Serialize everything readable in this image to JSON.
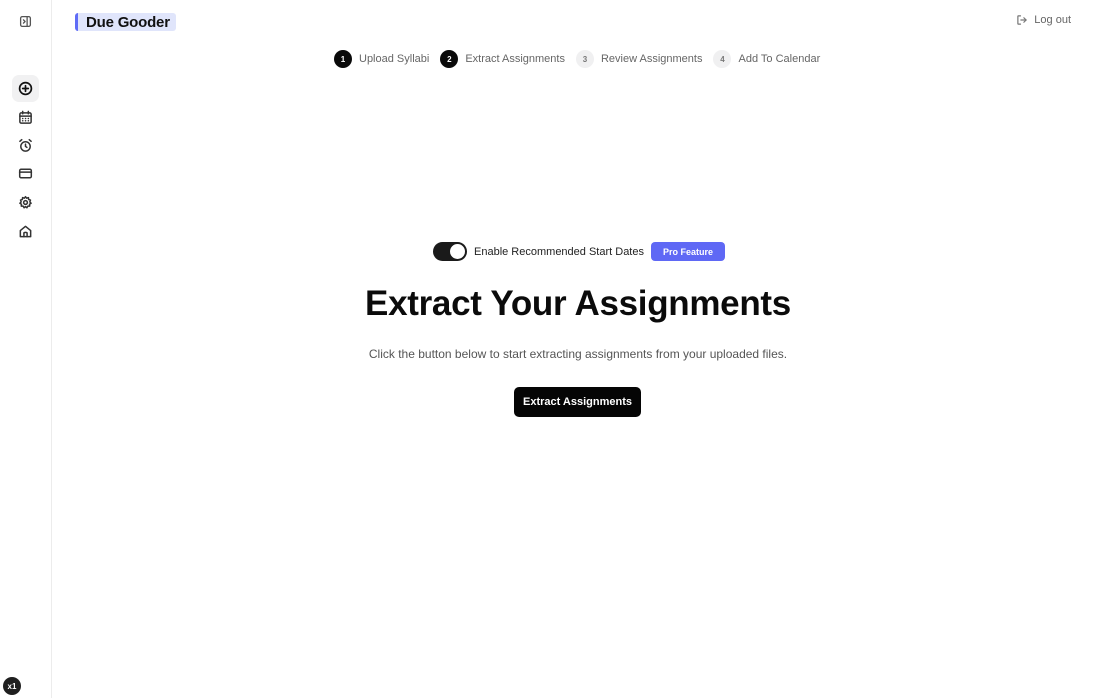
{
  "app": {
    "logo_text": "Due Gooder",
    "logout_label": "Log out",
    "zoom_badge": "x1"
  },
  "sidebar": {
    "items": [
      {
        "icon": "plus-circle-icon",
        "active": true
      },
      {
        "icon": "calendar-icon",
        "active": false
      },
      {
        "icon": "alarm-clock-icon",
        "active": false
      },
      {
        "icon": "credit-card-icon",
        "active": false
      },
      {
        "icon": "gear-icon",
        "active": false
      },
      {
        "icon": "home-icon",
        "active": false
      }
    ]
  },
  "stepper": {
    "steps": [
      {
        "number": "1",
        "label": "Upload Syllabi",
        "status": "complete"
      },
      {
        "number": "2",
        "label": "Extract Assignments",
        "status": "current"
      },
      {
        "number": "3",
        "label": "Review Assignments",
        "status": "upcoming"
      },
      {
        "number": "4",
        "label": "Add To Calendar",
        "status": "upcoming"
      }
    ]
  },
  "main": {
    "toggle_label": "Enable Recommended Start Dates",
    "toggle_on": true,
    "pro_badge": "Pro Feature",
    "heading": "Extract Your Assignments",
    "subtext": "Click the button below to start extracting assignments from your uploaded files.",
    "button_label": "Extract Assignments"
  },
  "colors": {
    "accent": "#5f68f5",
    "logo_bg": "#e0e5fb",
    "primary_button": "#050505"
  }
}
